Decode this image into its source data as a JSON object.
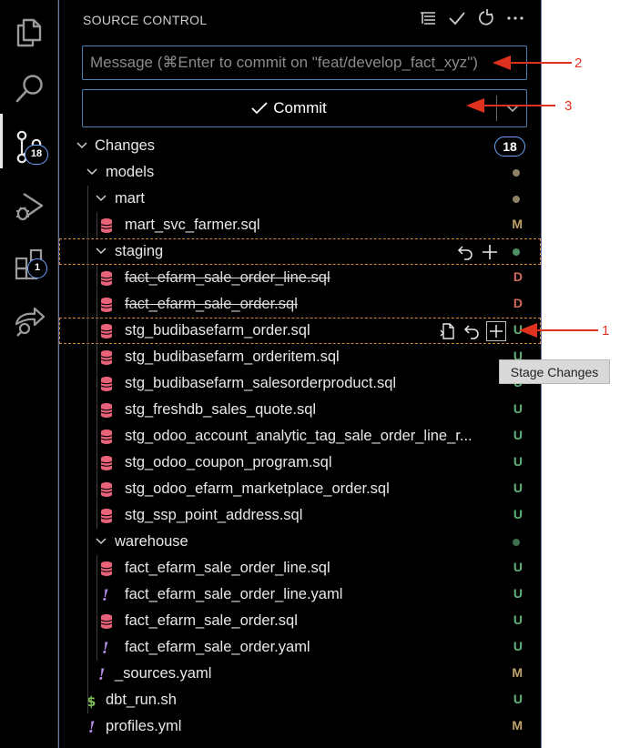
{
  "activity_bar": {
    "source_control_badge": "18",
    "extensions_badge": "1"
  },
  "sidebar": {
    "title": "SOURCE CONTROL",
    "message_placeholder": "Message (⌘Enter to commit on \"feat/develop_fact_xyz\")",
    "commit_label": "Commit",
    "changes_label": "Changes",
    "changes_count": "18",
    "rows": [
      {
        "label": "models",
        "type": "folder",
        "status": "",
        "dot": "#8f8068"
      },
      {
        "label": "mart",
        "type": "folder",
        "status": "",
        "dot": "#8f8068"
      },
      {
        "label": "mart_svc_farmer.sql",
        "type": "sql",
        "status": "M"
      },
      {
        "label": "staging",
        "type": "folder",
        "status": "",
        "dot": "#4f8f63"
      },
      {
        "label": "fact_efarm_sale_order_line.sql",
        "type": "sql",
        "status": "D"
      },
      {
        "label": "fact_efarm_sale_order.sql",
        "type": "sql",
        "status": "D"
      },
      {
        "label": "stg_budibasefarm_order.sql",
        "type": "sql",
        "status": "U"
      },
      {
        "label": "stg_budibasefarm_orderitem.sql",
        "type": "sql",
        "status": "U"
      },
      {
        "label": "stg_budibasefarm_salesorderproduct.sql",
        "type": "sql",
        "status": "U"
      },
      {
        "label": "stg_freshdb_sales_quote.sql",
        "type": "sql",
        "status": "U"
      },
      {
        "label": "stg_odoo_account_analytic_tag_sale_order_line_r...",
        "type": "sql",
        "status": "U"
      },
      {
        "label": "stg_odoo_coupon_program.sql",
        "type": "sql",
        "status": "U"
      },
      {
        "label": "stg_odoo_efarm_marketplace_order.sql",
        "type": "sql",
        "status": "U"
      },
      {
        "label": "stg_ssp_point_address.sql",
        "type": "sql",
        "status": "U"
      },
      {
        "label": "warehouse",
        "type": "folder",
        "status": "",
        "dot": "#3d6e4e"
      },
      {
        "label": "fact_efarm_sale_order_line.sql",
        "type": "sql",
        "status": "U"
      },
      {
        "label": "fact_efarm_sale_order_line.yaml",
        "type": "yaml",
        "status": "U"
      },
      {
        "label": "fact_efarm_sale_order.sql",
        "type": "sql",
        "status": "U"
      },
      {
        "label": "fact_efarm_sale_order.yaml",
        "type": "yaml",
        "status": "U"
      },
      {
        "label": "_sources.yaml",
        "type": "yaml",
        "status": "M"
      },
      {
        "label": "dbt_run.sh",
        "type": "sh",
        "status": "U"
      },
      {
        "label": "profiles.yml",
        "type": "yaml",
        "status": "M"
      }
    ]
  },
  "tooltip": "Stage Changes",
  "annotations": [
    "1",
    "2",
    "3"
  ],
  "colors": {
    "sql_icon": "#e8637a",
    "yaml_icon": "#b48ce8",
    "sh_icon": "#7fbf57",
    "annotation": "#e0301e",
    "highlight": "#d4873d"
  }
}
